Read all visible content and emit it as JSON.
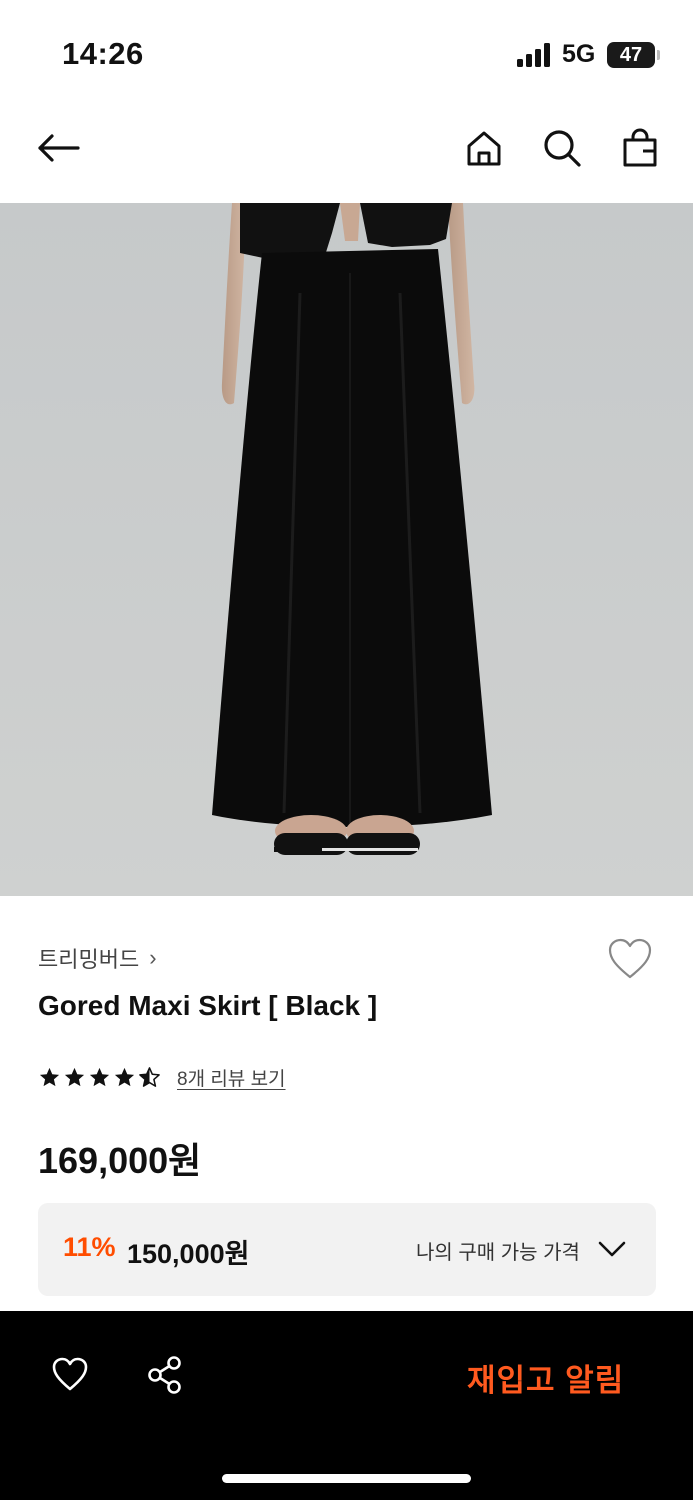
{
  "status_bar": {
    "time": "14:26",
    "network": "5G",
    "battery": "47"
  },
  "nav": {
    "back_icon": "arrow-left-icon",
    "home_icon": "home-icon",
    "search_icon": "search-icon",
    "cart_icon": "shopping-bag-icon"
  },
  "image_carousel": {
    "current_slide": 1,
    "total_slides": 3
  },
  "product": {
    "brand": "트리밍버드",
    "brand_chevron": "›",
    "name": "Gored Maxi Skirt [ Black ]",
    "rating": 4.5,
    "review_text": "8개 리뷰 보기",
    "price": "169,000원"
  },
  "discount_box": {
    "discount_rate": "11%",
    "sale_price": "150,000원",
    "my_price_label": "나의 구매 가능 가격"
  },
  "bottom_bar": {
    "wishlist_icon": "heart-icon",
    "share_icon": "share-icon",
    "restock_label": "재입고 알림"
  },
  "colors": {
    "accent": "#ff4d00",
    "bottom_bar_bg": "#000000",
    "price_box_bg": "#f2f2f2"
  }
}
